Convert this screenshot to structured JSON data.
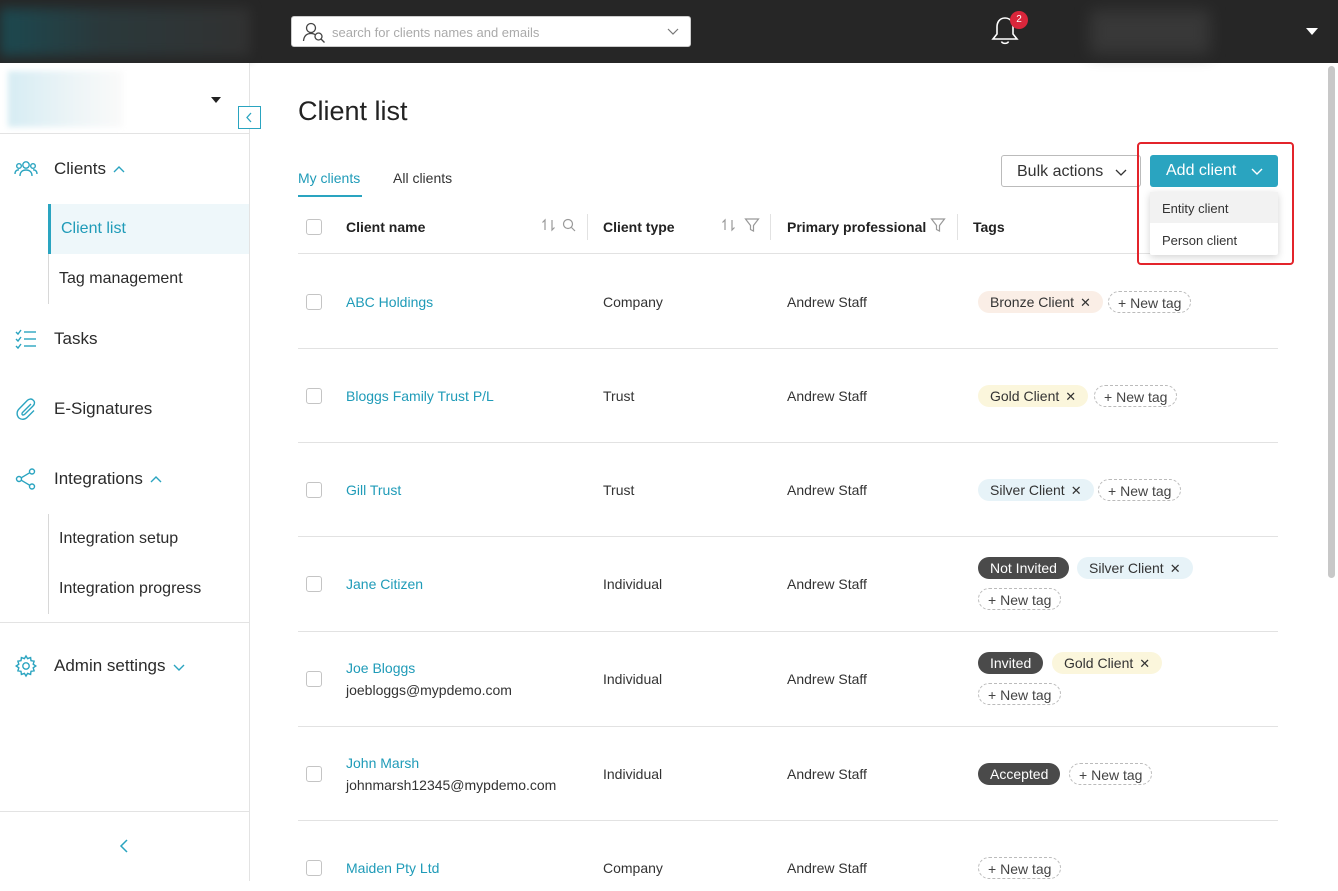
{
  "header": {
    "search_placeholder": "search for clients names and emails",
    "notification_count": "2"
  },
  "sidebar": {
    "clients_label": "Clients",
    "client_list_label": "Client list",
    "tag_management_label": "Tag management",
    "tasks_label": "Tasks",
    "esignatures_label": "E-Signatures",
    "integrations_label": "Integrations",
    "integration_setup_label": "Integration setup",
    "integration_progress_label": "Integration progress",
    "admin_settings_label": "Admin settings"
  },
  "main": {
    "title": "Client list",
    "tabs": [
      {
        "label": "My clients"
      },
      {
        "label": "All clients"
      }
    ],
    "bulk_actions_label": "Bulk actions",
    "add_client_label": "Add client",
    "add_client_menu": [
      {
        "label": "Entity client"
      },
      {
        "label": "Person client"
      }
    ],
    "columns": {
      "name": "Client name",
      "type": "Client type",
      "professional": "Primary professional",
      "tags": "Tags"
    },
    "new_tag_label": "New tag",
    "rows": [
      {
        "name": "ABC Holdings",
        "email": "",
        "type": "Company",
        "professional": "Andrew Staff",
        "tags": [
          "Bronze Client"
        ]
      },
      {
        "name": "Bloggs Family Trust P/L",
        "email": "",
        "type": "Trust",
        "professional": "Andrew Staff",
        "tags": [
          "Gold Client"
        ]
      },
      {
        "name": "Gill Trust",
        "email": "",
        "type": "Trust",
        "professional": "Andrew Staff",
        "tags": [
          "Silver Client"
        ]
      },
      {
        "name": "Jane Citizen",
        "email": "",
        "type": "Individual",
        "professional": "Andrew Staff",
        "tags": [
          "Not Invited",
          "Silver Client"
        ]
      },
      {
        "name": "Joe Bloggs",
        "email": "joebloggs@mypdemo.com",
        "type": "Individual",
        "professional": "Andrew Staff",
        "tags": [
          "Invited",
          "Gold Client"
        ]
      },
      {
        "name": "John Marsh",
        "email": "johnmarsh12345@mypdemo.com",
        "type": "Individual",
        "professional": "Andrew Staff",
        "tags": [
          "Accepted"
        ]
      },
      {
        "name": "Maiden Pty Ltd",
        "email": "",
        "type": "Company",
        "professional": "Andrew Staff",
        "tags": []
      }
    ]
  },
  "colors": {
    "accent": "#2aa4c0",
    "topbar": "#262626",
    "highlight": "#e3242b",
    "badge": "#d9263b"
  }
}
